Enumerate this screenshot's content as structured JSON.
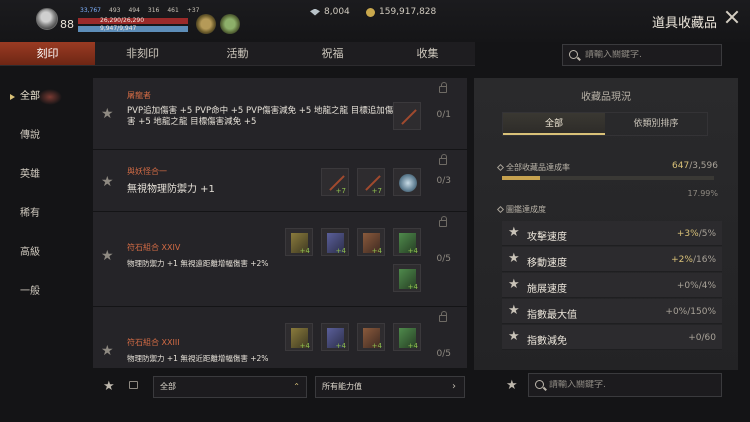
{
  "player": {
    "level": "88",
    "stats": [
      "33,767",
      "493",
      "494",
      "316",
      "461",
      "+37"
    ],
    "hp_text": "26,290/26,290",
    "mp_text": "9,947/9,947"
  },
  "currency": {
    "crystals": "8,004",
    "gold": "159,917,828"
  },
  "window": {
    "title": "道具收藏品"
  },
  "tabs": [
    {
      "label": "刻印"
    },
    {
      "label": "非刻印"
    },
    {
      "label": "活動"
    },
    {
      "label": "祝福"
    },
    {
      "label": "收集"
    }
  ],
  "search": {
    "placeholder": "請輸入關鍵字."
  },
  "sidebar": {
    "items": [
      {
        "label": "全部"
      },
      {
        "label": "傳說"
      },
      {
        "label": "英雄"
      },
      {
        "label": "稀有"
      },
      {
        "label": "高級"
      },
      {
        "label": "一般"
      }
    ]
  },
  "collections": [
    {
      "name": "屠龍者",
      "desc": "PVP追加傷害 +5 PVP命中 +5 PVP傷害減免 +5 地龍之龍 目標追加傷害 +5 地龍之龍 目標傷害減免 +5",
      "count": "0/1"
    },
    {
      "name": "與妖怪合一",
      "desc": "無視物理防禦力 +1",
      "count": "0/3"
    },
    {
      "name": "符石組合 XXIV",
      "desc": "物理防禦力 +1 無視遠距離增幅傷害 +2%",
      "count": "0/5"
    },
    {
      "name": "符石組合 XXIII",
      "desc": "物理防禦力 +1 無視近距離增幅傷害 +2%",
      "count": "0/5"
    }
  ],
  "filters": {
    "grade_select": "全部",
    "ability_select": "所有能力值"
  },
  "panel": {
    "title": "收藏品現況",
    "tabs": [
      "全部",
      "依類別排序"
    ],
    "rate_label": "全部收藏品達成率",
    "rate_current": "647",
    "rate_total": "/3,596",
    "rate_fraction": 0.1799,
    "rate_percent": "17.99%",
    "sub_title": "圖鑑達成度",
    "attributes": [
      {
        "name": "攻擊速度",
        "current": "+3%",
        "max": "/5%"
      },
      {
        "name": "移動速度",
        "current": "+2%",
        "max": "/16%"
      },
      {
        "name": "施展速度",
        "current": "+0%",
        "max": "/4%"
      },
      {
        "name": "指數最大值",
        "current": "+0%",
        "max": "/150%"
      },
      {
        "name": "指數減免",
        "current": "+0",
        "max": "/60"
      }
    ]
  },
  "bottom_search": {
    "placeholder": "請輸入關鍵字."
  },
  "colors": {
    "accent_tab": "#9a3b23",
    "gold": "#d9c178",
    "name_red": "#d26b45"
  }
}
